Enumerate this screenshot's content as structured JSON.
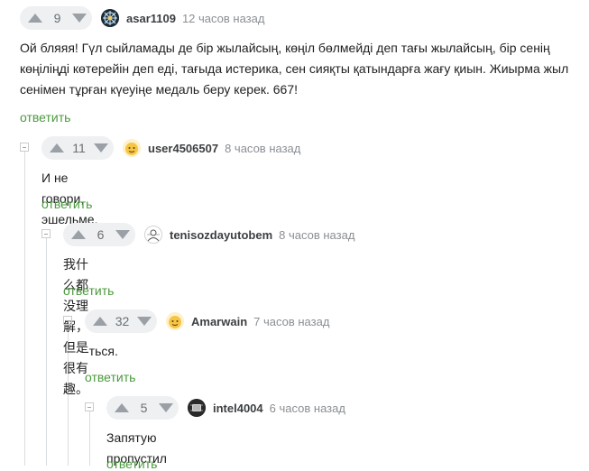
{
  "reply_label": "ответить",
  "comments": [
    {
      "score": "9",
      "username": "asar1109",
      "time": "12 часов назад",
      "text": "Ой бляяя! Гүл сыйламады де бір жылайсың, көңіл бөлмейді деп тағы жылайсың, бір сенің көңіліңді көтерейін деп еді, тағыда истерика, сен сияқты қатындарға жағу қиын. Жиырма жыл сенімен тұрған күеуіңе медаль беру керек. 667!",
      "avatar": "ornament-avatar"
    },
    {
      "score": "11",
      "username": "user4506507",
      "time": "8 часов назад",
      "text": "И не говори, эшельме.",
      "avatar": "emoji-face-avatar"
    },
    {
      "score": "6",
      "username": "tenisozdayutobem",
      "time": "8 часов назад",
      "text": "我什么都没理解，但是很有趣。",
      "avatar": "line-avatar"
    },
    {
      "score": "32",
      "username": "Amarwain",
      "time": "7 часов назад",
      "text": "-ться.",
      "avatar": "emoji-face-avatar"
    },
    {
      "score": "5",
      "username": "intel4004",
      "time": "6 часов назад",
      "text": "Запятую пропустил",
      "avatar": "chip-avatar"
    }
  ],
  "colors": {
    "reply_green": "#4a9a3c",
    "vote_bg": "#eef0f2",
    "arrow_gray": "#9aa0a6"
  }
}
